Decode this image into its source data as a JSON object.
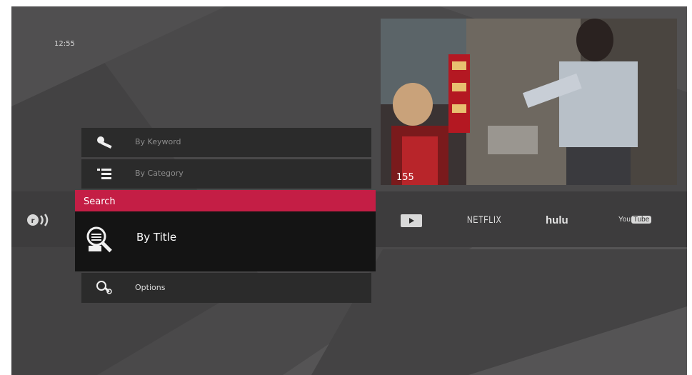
{
  "status": {
    "clock": "12:55"
  },
  "preview": {
    "channel_number": "155"
  },
  "menu": {
    "items": [
      {
        "label": "By Keyword",
        "icon": "key-icon"
      },
      {
        "label": "By Category",
        "icon": "list-icon"
      }
    ],
    "section_header": "Search",
    "selected": {
      "label": "By Title",
      "icon": "search-document-icon"
    },
    "footer_item": {
      "label": "Options",
      "icon": "options-search-icon"
    }
  },
  "rail": {
    "logo_icon": "rovi-logo-icon",
    "apps": [
      {
        "name": "play-app",
        "icon": "play-icon"
      },
      {
        "name": "netflix",
        "label": "NETFLIX"
      },
      {
        "name": "hulu",
        "label": "hulu"
      },
      {
        "name": "youtube",
        "label_prefix": "You",
        "label_suffix": "Tube"
      }
    ]
  },
  "colors": {
    "accent": "#c41e45",
    "background": "#4a494a",
    "menu_row": "#2b2b2b",
    "selected_row": "#141414"
  }
}
